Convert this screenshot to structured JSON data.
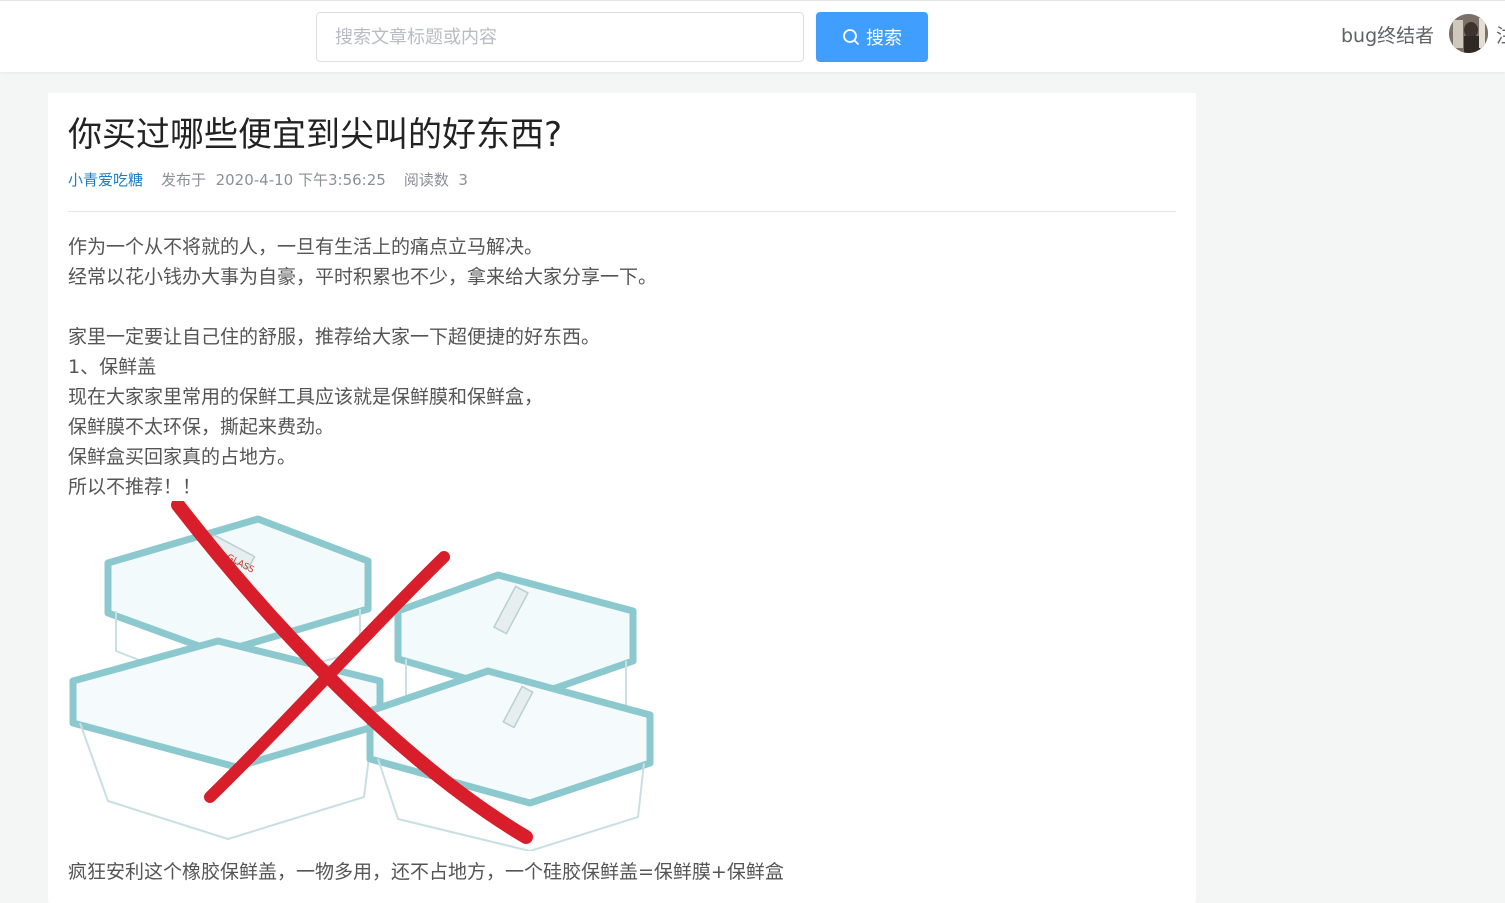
{
  "header": {
    "search_placeholder": "搜索文章标题或内容",
    "search_value": "",
    "search_button_label": "搜索",
    "username": "bug终结者",
    "cut_text": "注"
  },
  "article": {
    "title": "你买过哪些便宜到尖叫的好东西?",
    "author": "小青爱吃糖",
    "published_label": "发布于",
    "published_date": "2020-4-10 下午3:56:25",
    "read_label": "阅读数",
    "read_count": "3",
    "paragraphs": [
      "作为一个从不将就的人，一旦有生活上的痛点立马解决。",
      "经常以花小钱办大事为自豪，平时积累也不少，拿来给大家分享一下。",
      "",
      "家里一定要让自己住的舒服，推荐给大家一下超便捷的好东西。",
      "1、保鲜盖",
      "现在大家家里常用的保鲜工具应该就是保鲜膜和保鲜盒，",
      "保鲜膜不太环保，撕起来费劲。",
      "保鲜盒买回家真的占地方。",
      "所以不推荐！！"
    ],
    "image_label": "GLASS",
    "after_image": "疯狂安利这个橡胶保鲜盖，一物多用，还不占地方，一个硅胶保鲜盖=保鲜膜+保鲜盒"
  },
  "colors": {
    "accent": "#409eff",
    "author_link": "#1d7dc4",
    "lid_teal": "#8cc9cf",
    "cross_red": "#d81e2a"
  }
}
